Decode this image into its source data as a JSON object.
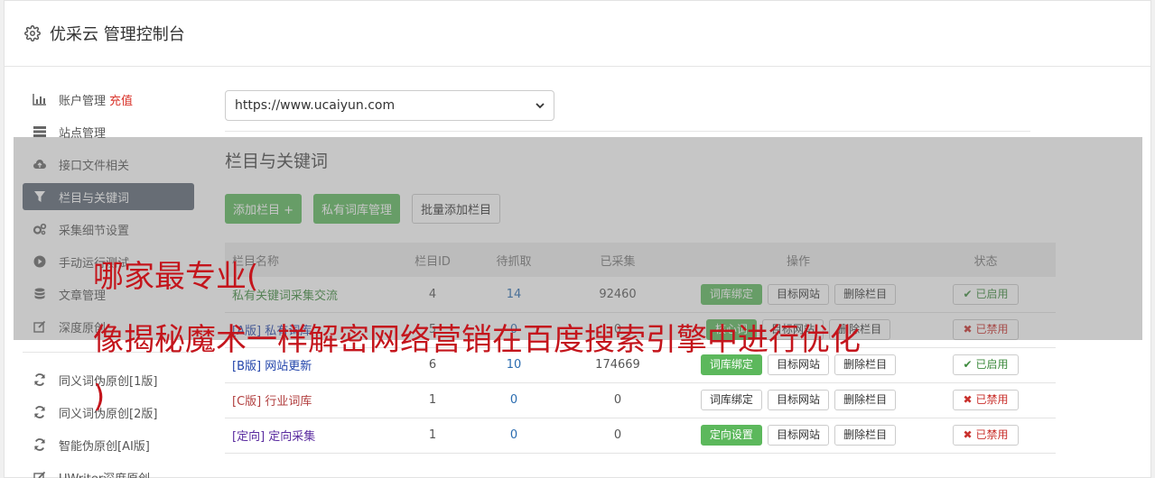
{
  "header": {
    "title": "优采云 管理控制台",
    "icon": "gear-icon"
  },
  "sidebar": {
    "items": [
      {
        "label": "账户管理",
        "extra": "充值",
        "icon": "bar-chart-icon"
      },
      {
        "label": "站点管理",
        "icon": "server-icon"
      },
      {
        "label": "接口文件相关",
        "icon": "cloud-upload-icon"
      },
      {
        "label": "栏目与关键词",
        "icon": "filter-icon",
        "active": true
      },
      {
        "label": "采集细节设置",
        "icon": "cogs-icon"
      },
      {
        "label": "手动运行测试",
        "icon": "play-circle-icon"
      },
      {
        "label": "文章管理",
        "icon": "database-icon"
      },
      {
        "label": "深度原创",
        "icon": "edit-icon"
      }
    ],
    "items2": [
      {
        "label": "同义词伪原创[1版]",
        "icon": "refresh-icon"
      },
      {
        "label": "同义词伪原创[2版]",
        "icon": "refresh-icon"
      },
      {
        "label": "智能伪原创[AI版]",
        "icon": "refresh-icon"
      },
      {
        "label": "UWriter深度原创",
        "icon": "edit-icon"
      }
    ]
  },
  "main": {
    "site_select": "https://www.ucaiyun.com",
    "section_title": "栏目与关键词",
    "buttons": {
      "add": "添加栏目 +",
      "private": "私有词库管理",
      "batch": "批量添加栏目"
    },
    "table": {
      "headers": [
        "栏目名称",
        "栏目ID",
        "待抓取",
        "已采集",
        "操作",
        "状态"
      ],
      "rows": [
        {
          "tag": "",
          "name": "私有关键词采集交流",
          "id": "4",
          "pending": "14",
          "collected": "92460",
          "bind": "词库绑定",
          "target": "目标网站",
          "delete": "删除栏目",
          "status": "已启用"
        },
        {
          "tag": "[A版]",
          "name": "私有词库",
          "id": "5",
          "pending": "0",
          "collected": "0",
          "bind": "核心词",
          "target": "目标网站",
          "delete": "删除栏目",
          "status": "已禁用"
        },
        {
          "tag": "[B版]",
          "name": "网站更新",
          "id": "6",
          "pending": "10",
          "collected": "174669",
          "bind": "词库绑定",
          "target": "目标网站",
          "delete": "删除栏目",
          "status": "已启用"
        },
        {
          "tag": "[C版]",
          "name": "行业词库",
          "id": "1",
          "pending": "0",
          "collected": "0",
          "bind": "词库绑定",
          "target": "目标网站",
          "delete": "删除栏目",
          "status": "已禁用"
        },
        {
          "tag": "[定向]",
          "name": "定向采集",
          "id": "1",
          "pending": "0",
          "collected": "0",
          "bind": "定向设置",
          "target": "目标网站",
          "delete": "删除栏目",
          "status": "已禁用"
        }
      ]
    }
  },
  "overlay": {
    "line1": "哪家最专业(",
    "line2": "像揭秘魔术一样解密网络营销在百度搜索引擎中进行优化",
    "line3": ")"
  },
  "colors": {
    "accent_green": "#5cb85c",
    "active_nav": "#5c6674",
    "overlay_text": "#c4151c"
  }
}
